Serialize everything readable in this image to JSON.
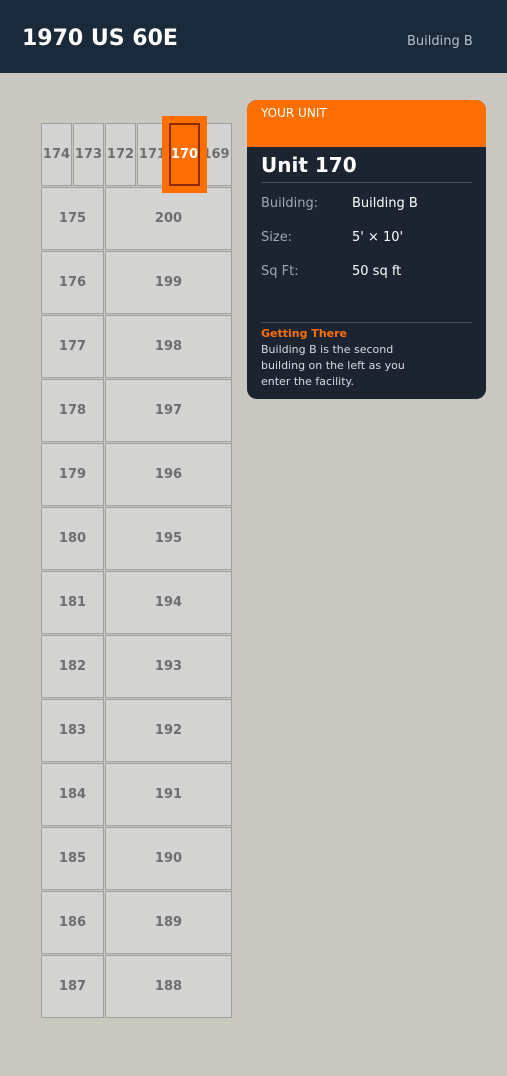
{
  "header": {
    "title": "1970 US 60E",
    "building": "Building B"
  },
  "map": {
    "selected_unit": "170",
    "colors": {
      "unit_fill": "#d3d3d1",
      "unit_border": "#9f9f9f",
      "selected_fill": "#ff6f00",
      "selected_outline": "#8f2a00"
    },
    "top_row": [
      "174",
      "173",
      "172",
      "171",
      "170",
      "169"
    ],
    "left_column": [
      "175",
      "176",
      "177",
      "178",
      "179",
      "180",
      "181",
      "182",
      "183",
      "184",
      "185",
      "186",
      "187"
    ],
    "right_column": [
      "200",
      "199",
      "198",
      "197",
      "196",
      "195",
      "194",
      "193",
      "192",
      "191",
      "190",
      "189",
      "188"
    ]
  },
  "card": {
    "kicker": "YOUR UNIT",
    "title": "Unit 170",
    "details": [
      {
        "label": "Building:",
        "value": "Building B"
      },
      {
        "label": "Size:",
        "value": "5' × 10'"
      },
      {
        "label": "Sq Ft:",
        "value": "50 sq ft"
      }
    ],
    "directions_title": "Getting There",
    "directions_text": "Building B is the second building on the left as you enter the facility."
  }
}
